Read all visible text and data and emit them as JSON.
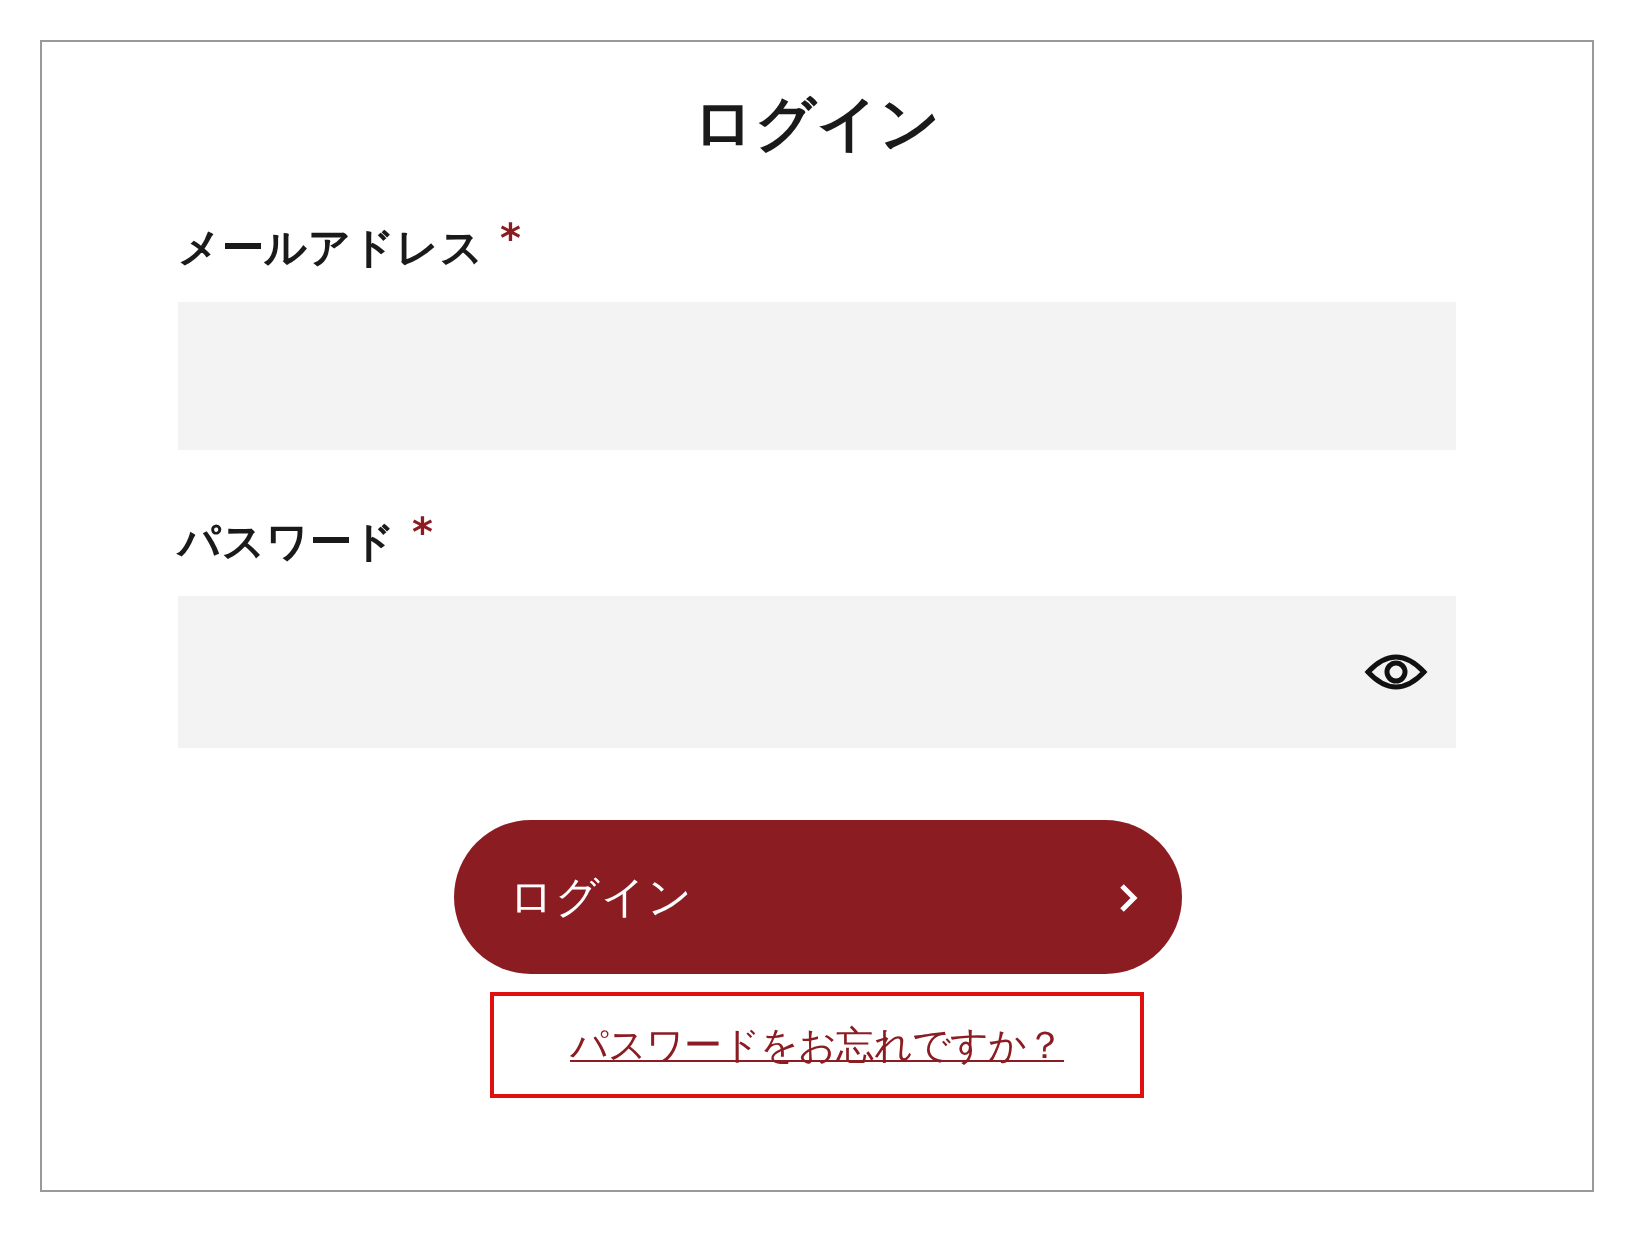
{
  "title": "ログイン",
  "fields": [
    {
      "label": "メールアドレス",
      "required_mark": "*",
      "kind": "text"
    },
    {
      "label": "パスワード",
      "required_mark": "*",
      "kind": "password"
    }
  ],
  "button": {
    "label": "ログイン"
  },
  "link": {
    "text": "パスワードをお忘れですか？",
    "highlighted": true
  }
}
